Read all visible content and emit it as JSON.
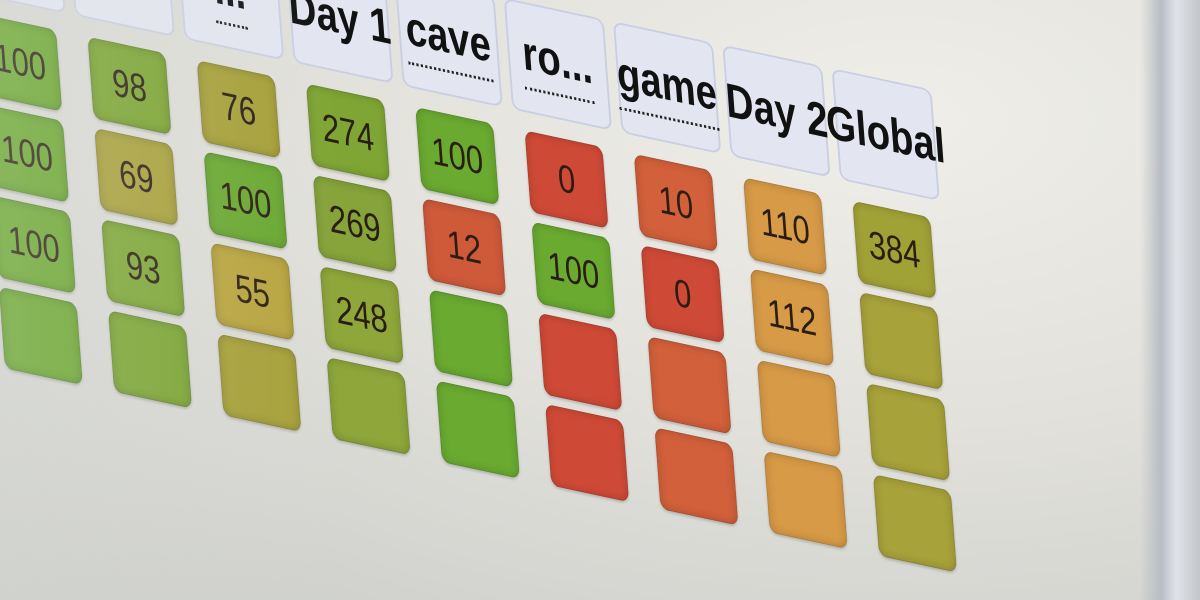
{
  "headers": [
    {
      "label": "...",
      "abbr": true
    },
    {
      "label": "Day 1",
      "abbr": false
    },
    {
      "label": "cave",
      "abbr": true
    },
    {
      "label": "ro...",
      "abbr": true
    },
    {
      "label": "game",
      "abbr": true
    },
    {
      "label": "Day 2",
      "abbr": false
    },
    {
      "label": "Global",
      "abbr": false
    }
  ],
  "leading_columns": 3,
  "rows": [
    [
      "100",
      "98",
      "76",
      "274",
      "100",
      "0",
      "10",
      "110",
      "384"
    ],
    [
      "100",
      "69",
      "100",
      "269",
      "12",
      "100",
      "0",
      "112",
      ""
    ],
    [
      "100",
      "93",
      "55",
      "248",
      "",
      "",
      "",
      "",
      ""
    ],
    [
      "",
      "",
      "",
      "",
      "",
      "",
      "",
      "",
      ""
    ]
  ],
  "cell_colors": [
    [
      "#6aa62e",
      "#7aa431",
      "#a6a038",
      "#7fa634",
      "#6aaa30",
      "#cf4a36",
      "#d2603a",
      "#d79a46",
      "#a1a236"
    ],
    [
      "#6aa62e",
      "#a8a03a",
      "#69a830",
      "#86a43a",
      "#cf5a3a",
      "#6aaa30",
      "#cf4a36",
      "#d79a46",
      "#a8a23a"
    ],
    [
      "#6aa62e",
      "#7ca634",
      "#b8a43e",
      "#8ea63a",
      "#6aaa30",
      "#cf4a36",
      "#d2603a",
      "#d79a46",
      "#a8a23a"
    ],
    [
      "#6aa62e",
      "#7aa431",
      "#a6a038",
      "#8ea63a",
      "#6aaa30",
      "#cf4a36",
      "#d2603a",
      "#d79a46",
      "#a8a23a"
    ]
  ]
}
